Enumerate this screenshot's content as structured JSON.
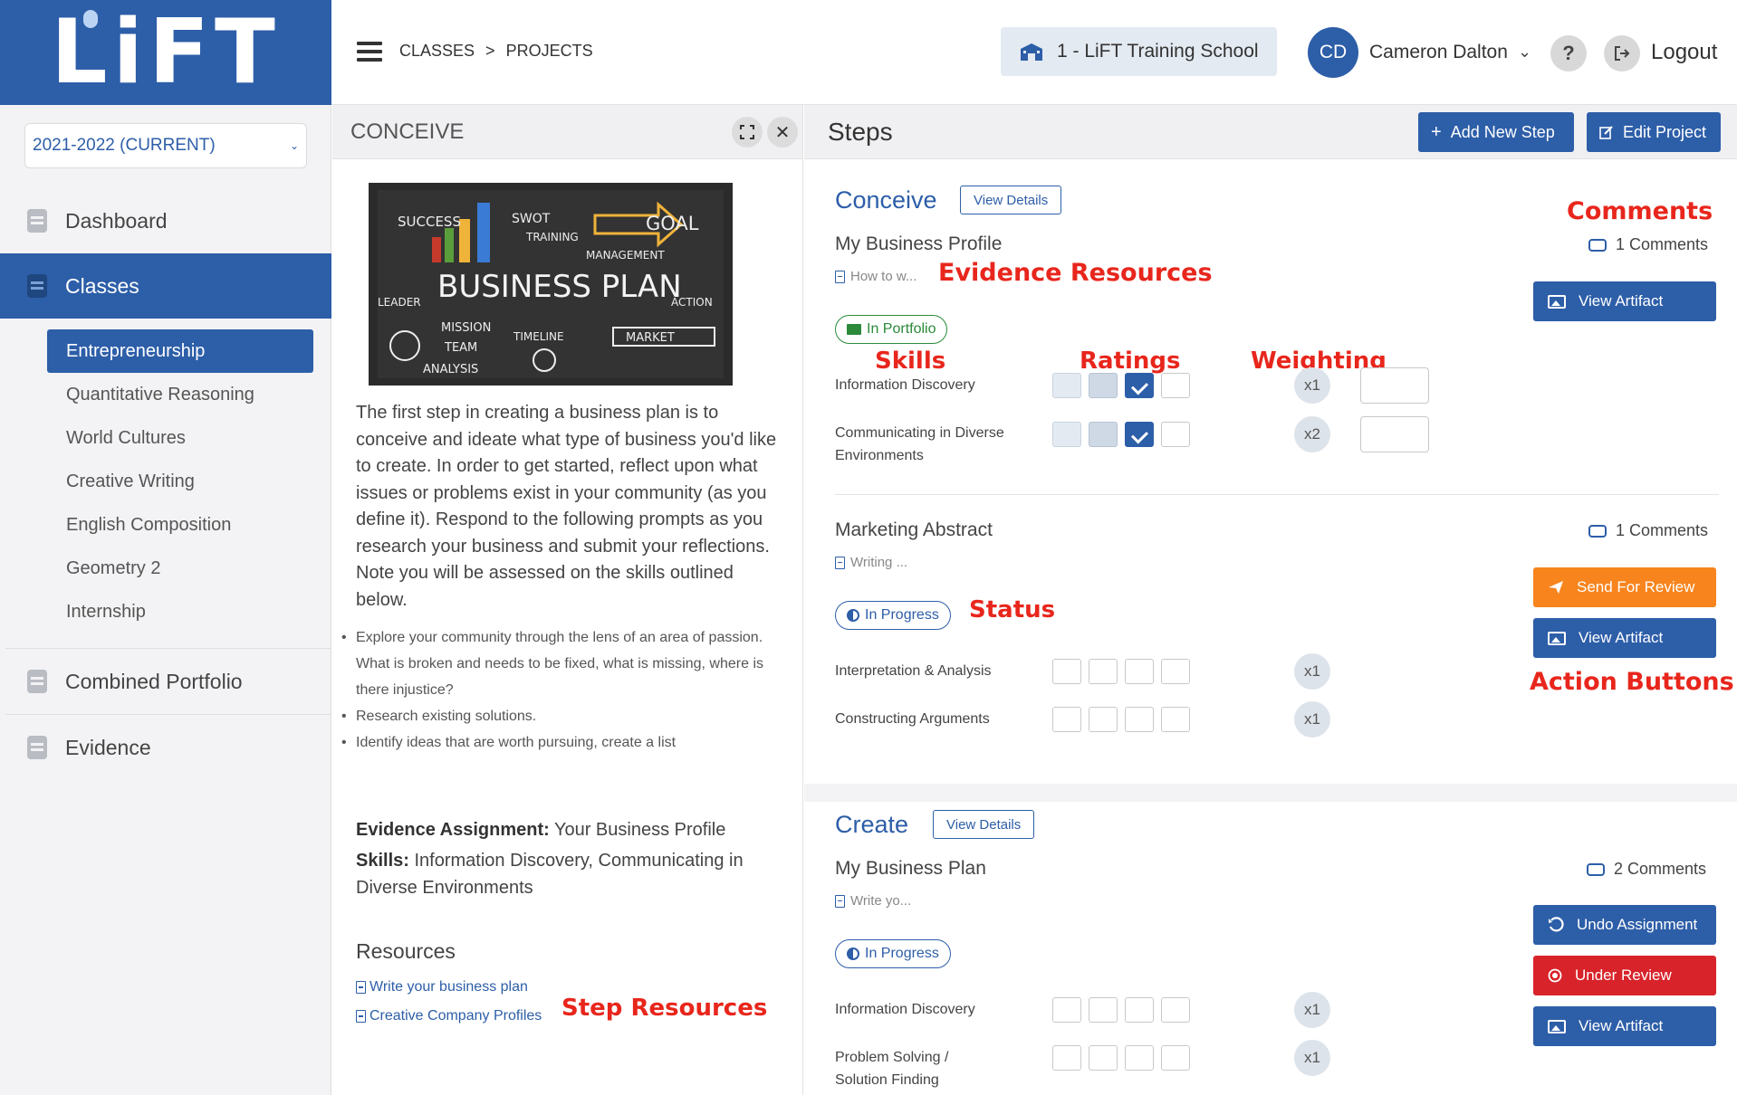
{
  "logo": "LiFT",
  "sidebar": {
    "year": "2021-2022 (CURRENT)",
    "items": [
      {
        "label": "Dashboard"
      },
      {
        "label": "Classes"
      },
      {
        "label": "Combined Portfolio"
      },
      {
        "label": "Evidence"
      }
    ],
    "classes": [
      {
        "label": "Entrepreneurship"
      },
      {
        "label": "Quantitative Reasoning"
      },
      {
        "label": "World Cultures"
      },
      {
        "label": "Creative Writing"
      },
      {
        "label": "English Composition"
      },
      {
        "label": "Geometry 2"
      },
      {
        "label": "Internship"
      }
    ]
  },
  "topbar": {
    "breadcrumb": [
      "CLASSES",
      ">",
      "PROJECTS"
    ],
    "school": "1 - LiFT Training School",
    "initials": "CD",
    "user": "Cameron Dalton",
    "help": "?",
    "logout": "Logout"
  },
  "mid": {
    "title": "CONCEIVE",
    "image_words": {
      "success": "SUCCESS",
      "swot": "SWOT",
      "training": "TRAINING",
      "goal": "GOAL",
      "management": "MANAGEMENT",
      "business_plan": "BUSINESS PLAN",
      "leader": "LEADER",
      "action": "ACTION",
      "mission": "MISSION",
      "team": "TEAM",
      "timeline": "TIMELINE",
      "market": "MARKET",
      "analysis": "ANALYSIS"
    },
    "body": "The first step in creating a business plan is to conceive and ideate what  type of business you'd like to create. In order to get started, reflect upon what issues or problems exist in your community (as you define  it). Respond to the following prompts as you research your business and  submit your reflections. Note you will be assessed on the skills  outlined below.",
    "bullets": [
      "Explore your community through the lens of an area of passion. What is broken and  needs to be fixed, what is missing, where is there injustice?",
      "Research existing solutions.",
      "Identify ideas that are worth pursuing, create a list"
    ],
    "evidence_label": "Evidence Assignment:",
    "evidence_value": "Your Business Profile",
    "skills_label": "Skills:",
    "skills_value": "Information Discovery, Communicating in Diverse Environments",
    "resources_title": "Resources",
    "resources": [
      "Write your business plan",
      "Creative Company Profiles"
    ]
  },
  "annotations": {
    "evidence_resources": "Evidence Resources",
    "comments": "Comments",
    "skills": "Skills",
    "ratings": "Ratings",
    "weighting": "Weighting",
    "status": "Status",
    "action_buttons": "Action Buttons",
    "step_resources": "Step Resources"
  },
  "right": {
    "title": "Steps",
    "add_step": "Add New Step",
    "edit_project": "Edit Project",
    "view_details": "View Details",
    "steps": [
      {
        "name": "Conceive",
        "assignments": [
          {
            "title": "My Business Profile",
            "resource": "How to w...",
            "status": "In Portfolio",
            "comments": "1 Comments",
            "skills": [
              {
                "name": "Information Discovery",
                "weight": "x1",
                "rating": 3
              },
              {
                "name": "Communicating in Diverse Environments",
                "weight": "x2",
                "rating": 3
              }
            ],
            "buttons": [
              "View Artifact"
            ]
          },
          {
            "title": "Marketing Abstract",
            "resource": "Writing ...",
            "status": "In Progress",
            "comments": "1 Comments",
            "skills": [
              {
                "name": "Interpretation & Analysis",
                "weight": "x1",
                "rating": 0
              },
              {
                "name": "Constructing Arguments",
                "weight": "x1",
                "rating": 0
              }
            ],
            "buttons": [
              "Send For Review",
              "View Artifact"
            ]
          }
        ]
      },
      {
        "name": "Create",
        "assignments": [
          {
            "title": "My Business Plan",
            "resource": "Write yo...",
            "status": "In Progress",
            "comments": "2 Comments",
            "skills": [
              {
                "name": "Information Discovery",
                "weight": "x1",
                "rating": 0
              },
              {
                "name": "Problem Solving / Solution Finding",
                "weight": "x1",
                "rating": 0
              }
            ],
            "buttons": [
              "Undo Assignment",
              "Under Review",
              "View Artifact"
            ]
          }
        ]
      }
    ]
  },
  "colors": {
    "brand": "#2d5ea8",
    "annotation": "#e8261c",
    "orange": "#f7841d",
    "red": "#d8232a",
    "green": "#2a8a3a"
  }
}
